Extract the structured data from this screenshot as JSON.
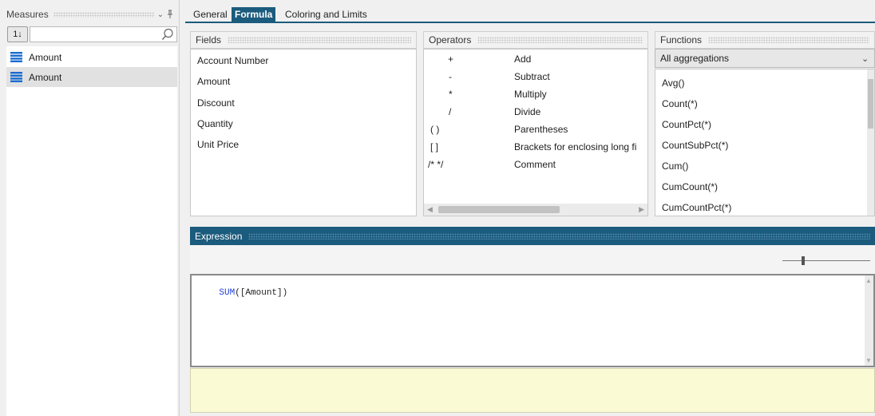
{
  "left_panel": {
    "title": "Measures",
    "items": [
      {
        "label": "Amount",
        "icon": "list-icon"
      },
      {
        "label": "Amount",
        "icon": "list-icon"
      }
    ],
    "sort_label": "1↓"
  },
  "tabs": [
    "General",
    "Formula",
    "Coloring and Limits"
  ],
  "fields": {
    "title": "Fields",
    "items": [
      "Account Number",
      "Amount",
      "Discount",
      "Quantity",
      "Unit Price"
    ]
  },
  "operators": {
    "title": "Operators",
    "items": [
      {
        "symbol": "+",
        "name": "Add"
      },
      {
        "symbol": "-",
        "name": "Subtract"
      },
      {
        "symbol": "*",
        "name": "Multiply"
      },
      {
        "symbol": "/",
        "name": "Divide"
      },
      {
        "symbol": "( )",
        "name": "Parentheses"
      },
      {
        "symbol": "[ ]",
        "name": "Brackets for enclosing long fi"
      },
      {
        "symbol": "/* */",
        "name": "Comment"
      }
    ]
  },
  "functions": {
    "title": "Functions",
    "dropdown_value": "All aggregations",
    "items": [
      "Avg()",
      "Count(*)",
      "CountPct(*)",
      "CountSubPct(*)",
      "Cum()",
      "CumCount(*)",
      "CumCountPct(*)"
    ]
  },
  "expression": {
    "title": "Expression",
    "keyword": "SUM",
    "rest": "([Amount])"
  },
  "colors": {
    "accent": "#1b5b7d",
    "selected_row": "#e1e1e1",
    "keyword": "#1f3fd4",
    "note_area": "#fafad4"
  }
}
